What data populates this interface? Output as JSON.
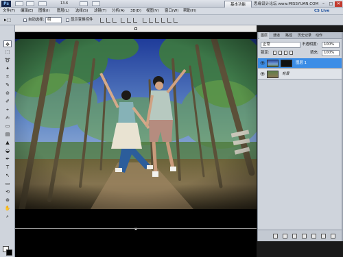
{
  "app": {
    "logo": "Ps",
    "zoom": "13.6",
    "workspace_button": "基本功能",
    "watermark": "思缘设计论坛 www.MISSYUAN.COM",
    "cs_live": "CS Live"
  },
  "menu": [
    "文件(F)",
    "编辑(E)",
    "图像(I)",
    "图层(L)",
    "选择(S)",
    "滤镜(T)",
    "分析(A)",
    "3D(D)",
    "视图(V)",
    "窗口(W)",
    "帮助(H)"
  ],
  "options": {
    "auto_select_label": "自动选择:",
    "auto_select_value": "组",
    "show_transform_label": "显示变换控件"
  },
  "layers_panel": {
    "tabs": [
      "图层",
      "通道",
      "路径",
      "历史记录",
      "动作"
    ],
    "blend_mode": "正常",
    "opacity_label": "不透明度:",
    "opacity_value": "100%",
    "lock_label": "锁定:",
    "fill_label": "填充:",
    "fill_value": "100%",
    "layers": [
      {
        "name": "图层 1",
        "selected": true
      },
      {
        "name": "背景",
        "selected": false
      }
    ]
  },
  "window_controls": {
    "minimize": "–",
    "maximize": "□",
    "close": "✕"
  },
  "icons": {
    "tool_glyphs": [
      "⊕",
      "⬚",
      "⌒",
      "✦",
      "⌗",
      "⊘",
      "✎",
      "✐",
      "⌖",
      "⎙",
      "◒",
      "▲",
      "⬤",
      "✒",
      "T",
      "↖",
      "▭",
      "✋",
      "⌕"
    ]
  }
}
